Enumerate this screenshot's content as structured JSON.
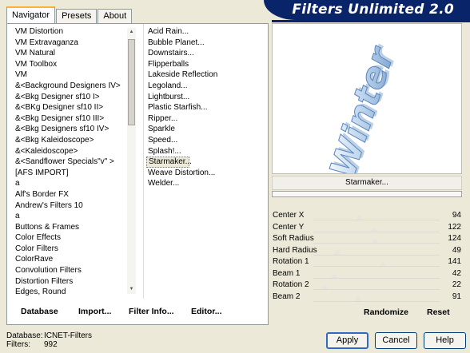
{
  "header": {
    "title": "Filters Unlimited 2.0"
  },
  "tabs": [
    "Navigator",
    "Presets",
    "About"
  ],
  "categories": [
    "VM Distortion",
    "VM Extravaganza",
    "VM Natural",
    "VM Toolbox",
    "VM",
    "&<Background Designers IV>",
    "&<Bkg Designer sf10 I>",
    "&<BKg Designer sf10 II>",
    "&<Bkg Designer sf10 III>",
    "&<Bkg Designers sf10 IV>",
    "&<Bkg Kaleidoscope>",
    "&<Kaleidoscope>",
    "&<Sandflower Specials\"v\" >",
    "[AFS IMPORT]",
    "a",
    "Alf's Border FX",
    "Andrew's Filters 10",
    "a",
    "Buttons & Frames",
    "Color Effects",
    "Color Filters",
    "ColorRave",
    "Convolution Filters",
    "Distortion Filters",
    "Edges, Round",
    "Edges, Square"
  ],
  "filters": [
    "Acid Rain...",
    "Bubble Planet...",
    "Downstairs...",
    "Flipperballs",
    "Lakeside Reflection",
    "Legoland...",
    "Lightburst...",
    "Plastic Starfish...",
    "Ripper...",
    "Sparkle",
    "Speed...",
    "Splash!...",
    "Starmaker...",
    "Weave Distortion...",
    "Welder..."
  ],
  "selected_filter_index": 12,
  "left_buttons": {
    "database": "Database",
    "import": "Import...",
    "filter_info": "Filter Info...",
    "editor": "Editor..."
  },
  "preview": {
    "text": "Winter"
  },
  "filter_name_button": "Starmaker...",
  "sliders": [
    {
      "label": "Center X",
      "value": 94
    },
    {
      "label": "Center Y",
      "value": 122
    },
    {
      "label": "Soft Radius",
      "value": 124
    },
    {
      "label": "Hard Radius",
      "value": 49
    },
    {
      "label": "Rotation 1",
      "value": 141
    },
    {
      "label": "Beam 1",
      "value": 42
    },
    {
      "label": "Rotation 2",
      "value": 22
    },
    {
      "label": "Beam 2",
      "value": 91
    }
  ],
  "right_buttons": {
    "randomize": "Randomize",
    "reset": "Reset"
  },
  "status": {
    "database_label": "Database:",
    "database_value": "ICNET-Filters",
    "filters_label": "Filters:",
    "filters_value": "992"
  },
  "dialog_buttons": {
    "apply": "Apply",
    "cancel": "Cancel",
    "help": "Help"
  },
  "colors": {
    "header_bg": "#0a246a",
    "window_bg": "#ece9d8",
    "tab_accent": "#f9b233"
  }
}
